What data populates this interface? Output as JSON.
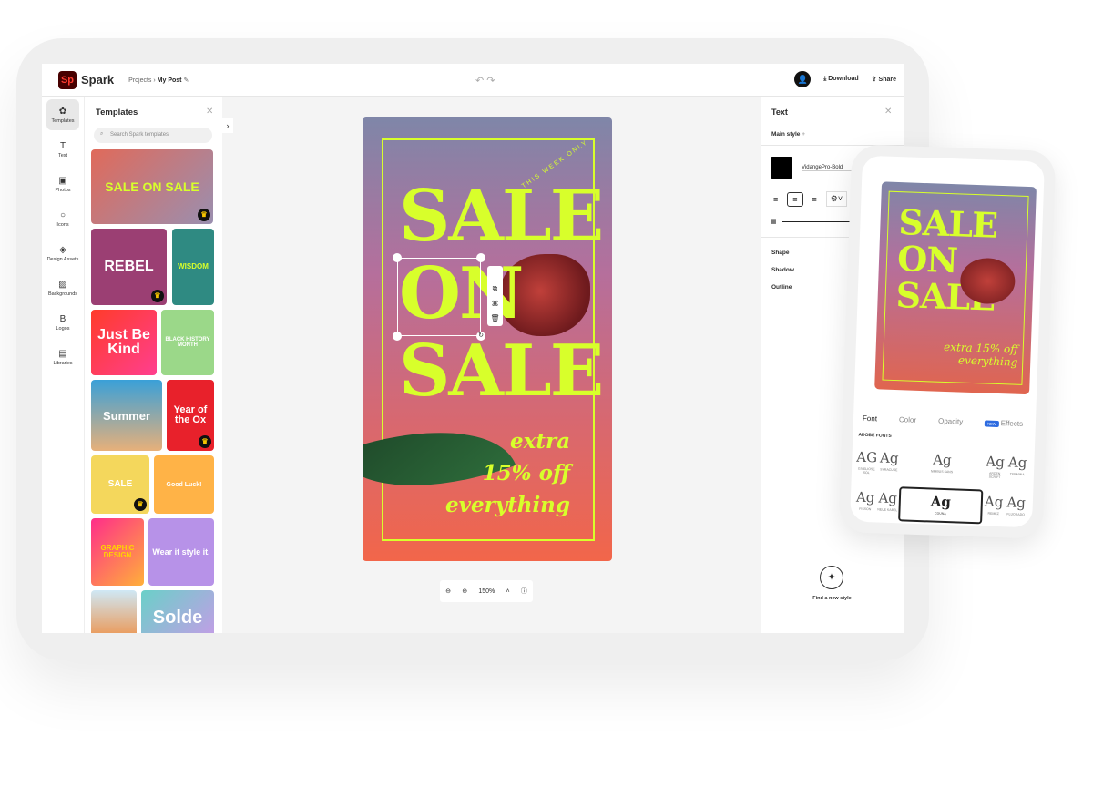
{
  "header": {
    "brand": "Spark",
    "logo": "Sp",
    "breadcrumb_root": "Projects",
    "breadcrumb_current": "My Post",
    "download": "Download",
    "share": "Share"
  },
  "rail": [
    {
      "label": "Templates",
      "icon": "templates-icon",
      "glyph": "✿"
    },
    {
      "label": "Text",
      "icon": "text-icon",
      "glyph": "T"
    },
    {
      "label": "Photos",
      "icon": "photos-icon",
      "glyph": "▣"
    },
    {
      "label": "Icons",
      "icon": "icons-icon",
      "glyph": "○"
    },
    {
      "label": "Design Assets",
      "icon": "design-assets-icon",
      "glyph": "◈"
    },
    {
      "label": "Backgrounds",
      "icon": "backgrounds-icon",
      "glyph": "▨"
    },
    {
      "label": "Logos",
      "icon": "logos-icon",
      "glyph": "B"
    },
    {
      "label": "Libraries",
      "icon": "libraries-icon",
      "glyph": "▤"
    }
  ],
  "templates": {
    "title": "Templates",
    "search_placeholder": "Search Spark templates",
    "items": [
      "SALE ON SALE",
      "REBEL",
      "WISDOM",
      "Just Be Kind",
      "BLACK HISTORY MONTH",
      "Summer",
      "Year of the Ox",
      "SALE",
      "Good Luck!",
      "GRAPHIC DESIGN",
      "Wear it style it.",
      "",
      "Solde"
    ]
  },
  "poster": {
    "tag": "THIS WEEK ONLY",
    "line1": "SALE",
    "line2": "ON",
    "line3": "SALE",
    "script1": "extra",
    "script2": "15% off",
    "script3": "everything"
  },
  "zoom": {
    "level": "150%"
  },
  "text_panel": {
    "title": "Text",
    "main_style": "Main style",
    "font_name": "VidangePro-Bold",
    "sections": [
      "Shape",
      "Shadow",
      "Outline"
    ],
    "find_style": "Find a new style"
  },
  "phone": {
    "tabs": [
      "Font",
      "Color",
      "Opacity",
      "Effects"
    ],
    "new_badge": "NEW",
    "fonts_heading": "ADOBE FONTS",
    "fonts": [
      {
        "g": "AG",
        "n": "GIVELIOSE SOL"
      },
      {
        "g": "Ag",
        "n": "SYRACUSE"
      },
      {
        "g": "Ag",
        "n": "NIMBUS SANS"
      },
      {
        "g": "Ag",
        "n": "ARDEN SCRIPT"
      },
      {
        "g": "Ag",
        "n": "TERMINA"
      },
      {
        "g": "Ag",
        "n": "FISSON"
      },
      {
        "g": "Ag",
        "n": "NEUE KABEL"
      },
      {
        "g": "Ag",
        "n": "COUNA"
      },
      {
        "g": "Ag",
        "n": "REMEZ"
      },
      {
        "g": "Ag",
        "n": "FLUORADO"
      }
    ]
  },
  "colors": {
    "accent": "#d8ff2b",
    "brand_bg": "#470000",
    "brand_fg": "#ff3b2f",
    "effects_badge": "#2d6be0"
  }
}
